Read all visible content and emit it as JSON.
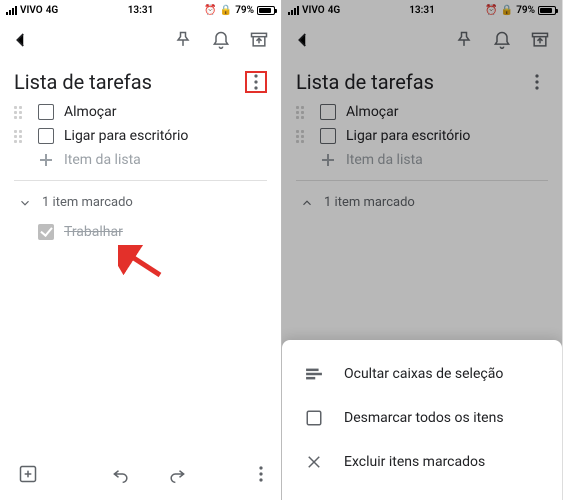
{
  "status": {
    "carrier": "VIVO",
    "network": "4G",
    "time": "13:31",
    "battery_pct": "79%"
  },
  "note": {
    "title": "Lista de tarefas"
  },
  "items": [
    {
      "text": "Almoçar"
    },
    {
      "text": "Ligar para escritório"
    }
  ],
  "placeholder": "Item da lista",
  "checked_section": {
    "label": "1 item marcado"
  },
  "checked_items": [
    {
      "text": "Trabalhar"
    }
  ],
  "sheet": {
    "hide_checkboxes": "Ocultar caixas de seleção",
    "uncheck_all": "Desmarcar todos os itens",
    "delete_checked": "Excluir itens marcados"
  }
}
